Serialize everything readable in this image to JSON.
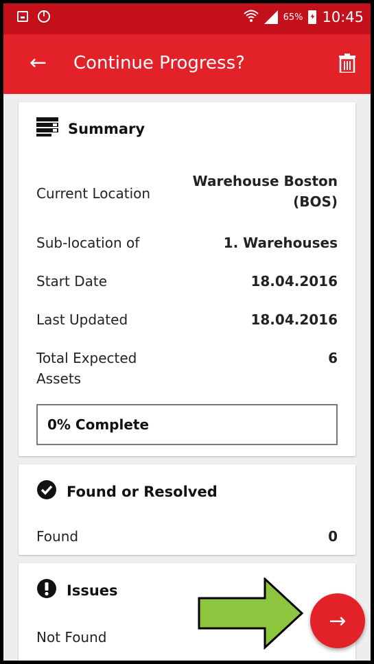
{
  "status_bar": {
    "battery_percent": "65%",
    "time": "10:45",
    "icons": [
      "screenshot-icon",
      "power-icon",
      "wifi-icon",
      "signal-icon",
      "battery-charging-icon"
    ]
  },
  "app_bar": {
    "title": "Continue Progress?",
    "back_icon": "arrow-left-icon",
    "delete_icon": "trash-icon"
  },
  "summary": {
    "title": "Summary",
    "icon": "summary-icon",
    "rows": [
      {
        "label": "Current Location",
        "value": "Warehouse Boston (BOS)"
      },
      {
        "label": "Sub-location of",
        "value": "1. Warehouses"
      },
      {
        "label": "Start Date",
        "value": "18.04.2016"
      },
      {
        "label": "Last Updated",
        "value": "18.04.2016"
      },
      {
        "label": "Total Expected Assets",
        "value": "6"
      }
    ],
    "progress_text": "0% Complete",
    "progress_percent": 0
  },
  "found": {
    "title": "Found or Resolved",
    "icon": "check-circle-icon",
    "rows": [
      {
        "label": "Found",
        "value": "0"
      }
    ]
  },
  "issues": {
    "title": "Issues",
    "icon": "exclamation-circle-icon",
    "rows": [
      {
        "label": "Not Found",
        "value": ""
      }
    ]
  },
  "fab": {
    "icon": "arrow-right-icon",
    "glyph": "→"
  },
  "annotation": {
    "icon": "green-arrow-pointer"
  },
  "colors": {
    "status_bar": "#c4101a",
    "app_bar": "#e32128",
    "fab": "#e32128",
    "annotation_arrow": "#8dc53e"
  }
}
